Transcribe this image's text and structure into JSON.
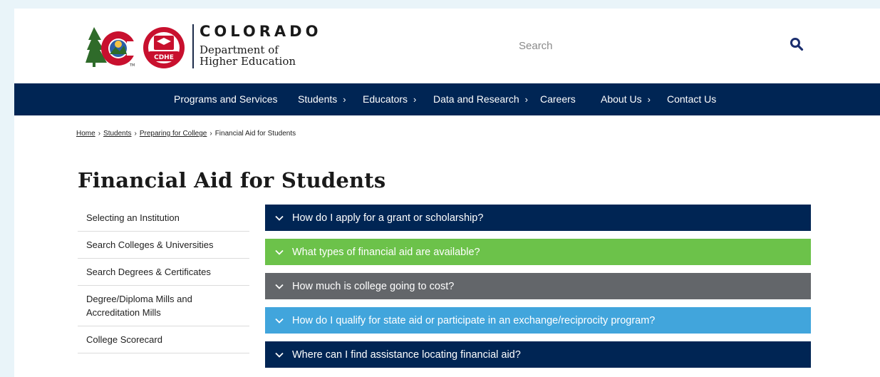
{
  "logo": {
    "state": "COLORADO",
    "dept_line1": "Department of",
    "dept_line2": "Higher Education",
    "badge": "CDHE",
    "mark": "TM"
  },
  "search": {
    "placeholder": "Search",
    "icon": "search-icon"
  },
  "nav": {
    "items": [
      {
        "label": "Programs and Services",
        "chevron": ""
      },
      {
        "label": "Students",
        "chevron": "›"
      },
      {
        "label": "Educators",
        "chevron": "›"
      },
      {
        "label": "Data and Research",
        "chevron": "›"
      },
      {
        "label": "Careers",
        "chevron": ""
      },
      {
        "label": "About Us",
        "chevron": "›"
      },
      {
        "label": "Contact Us",
        "chevron": ""
      }
    ]
  },
  "breadcrumb": {
    "items": [
      "Home",
      "Students",
      "Preparing for College"
    ],
    "current": "Financial Aid for Students",
    "separator": "›"
  },
  "page_title": "Financial Aid for Students",
  "sidebar": {
    "items": [
      {
        "label": "Selecting an Institution"
      },
      {
        "label": "Search Colleges & Universities"
      },
      {
        "label": "Search Degrees & Certificates"
      },
      {
        "label": "Degree/Diploma Mills and Accreditation Mills"
      },
      {
        "label": "College Scorecard"
      }
    ]
  },
  "accordion": {
    "items": [
      {
        "label": "How do I apply for a grant or scholarship?",
        "color": "#002554"
      },
      {
        "label": "What types of financial aid are available?",
        "color": "#6cc24a"
      },
      {
        "label": "How much is college going to cost?",
        "color": "#63666a"
      },
      {
        "label": "How do I qualify for state aid or participate in an exchange/reciprocity program?",
        "color": "#41a5dc"
      },
      {
        "label": "Where can I find assistance locating financial aid?",
        "color": "#002554"
      }
    ]
  },
  "colors": {
    "nav_bg": "#002554",
    "page_bg": "#e9f4f9",
    "search_icon": "#1b2e6e"
  }
}
